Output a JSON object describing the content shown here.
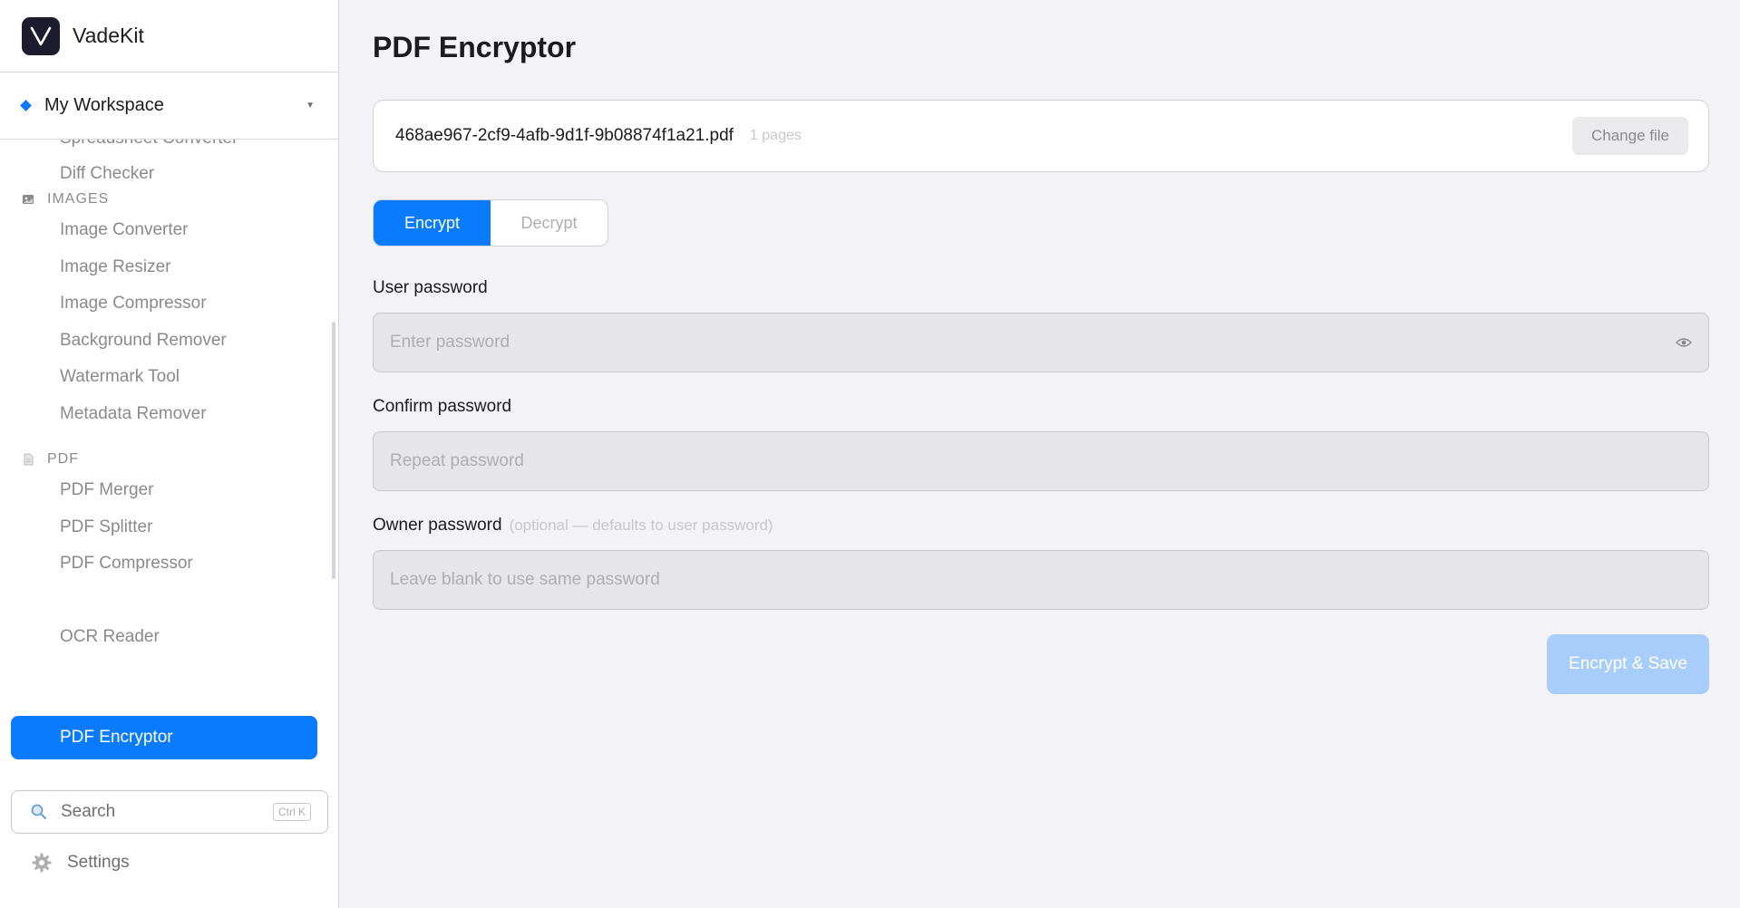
{
  "app": {
    "name": "VadeKit",
    "logo_letter": "V"
  },
  "workspace": {
    "name": "My Workspace"
  },
  "sidebar": {
    "items_top": [
      "Spreadsheet Converter",
      "Diff Checker"
    ],
    "images_header": "IMAGES",
    "images_items": [
      "Image Converter",
      "Image Resizer",
      "Image Compressor",
      "Background Remover",
      "Watermark Tool",
      "Metadata Remover"
    ],
    "pdf_header": "PDF",
    "pdf_items": [
      "PDF Merger",
      "PDF Splitter",
      "PDF Compressor"
    ],
    "active_item": "PDF Encryptor",
    "next_item": "OCR Reader"
  },
  "search": {
    "label": "Search",
    "shortcut": "Ctrl K"
  },
  "settings": {
    "label": "Settings"
  },
  "main": {
    "title": "PDF Encryptor",
    "file": {
      "name": "468ae967-2cf9-4afb-9d1f-9b08874f1a21.pdf",
      "pages": "1 pages",
      "change_label": "Change file"
    },
    "mode": {
      "encrypt": "Encrypt",
      "decrypt": "Decrypt",
      "selected": "Encrypt"
    },
    "user_password": {
      "label": "User password",
      "placeholder": "Enter password"
    },
    "confirm_password": {
      "label": "Confirm password",
      "placeholder": "Repeat password"
    },
    "owner_password": {
      "label": "Owner password",
      "hint": "(optional — defaults to user password)",
      "placeholder": "Leave blank to use same password"
    },
    "submit_label": "Encrypt & Save"
  },
  "colors": {
    "accent": "#0a7aff",
    "accent_disabled": "#a8cdfb",
    "background": "#f2f2f7"
  }
}
